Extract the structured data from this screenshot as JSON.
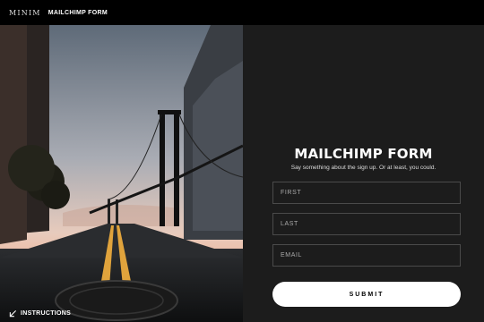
{
  "header": {
    "logo": "MINIM",
    "title": "MAILCHIMP FORM"
  },
  "form": {
    "title": "MAILCHIMP FORM",
    "subtitle": "Say something about the sign up. Or at least, you could.",
    "fields": [
      {
        "placeholder": "FIRST"
      },
      {
        "placeholder": "LAST"
      },
      {
        "placeholder": "EMAIL"
      }
    ],
    "submit_label": "SUBMIT"
  },
  "footer": {
    "instructions_label": "INSTRUCTIONS",
    "icon": "arrow-down-left-icon"
  }
}
